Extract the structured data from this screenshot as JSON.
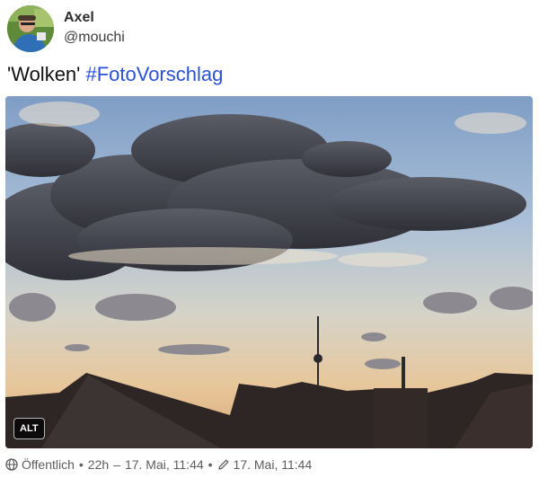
{
  "author": {
    "name": "Axel",
    "handle": "@mouchi"
  },
  "post": {
    "text_quote": "'Wolken' ",
    "hashtag": "#FotoVorschlag"
  },
  "media": {
    "alt_label": "ALT"
  },
  "meta": {
    "visibility_icon": "globe-icon",
    "visibility": "Öffentlich",
    "relative_time": "22h",
    "timestamp": "17. Mai, 11:44",
    "edited_icon": "pencil-icon",
    "edited_time": "17. Mai, 11:44"
  },
  "colors": {
    "link": "#2b50d8",
    "meta_text": "#5c5c5c"
  }
}
